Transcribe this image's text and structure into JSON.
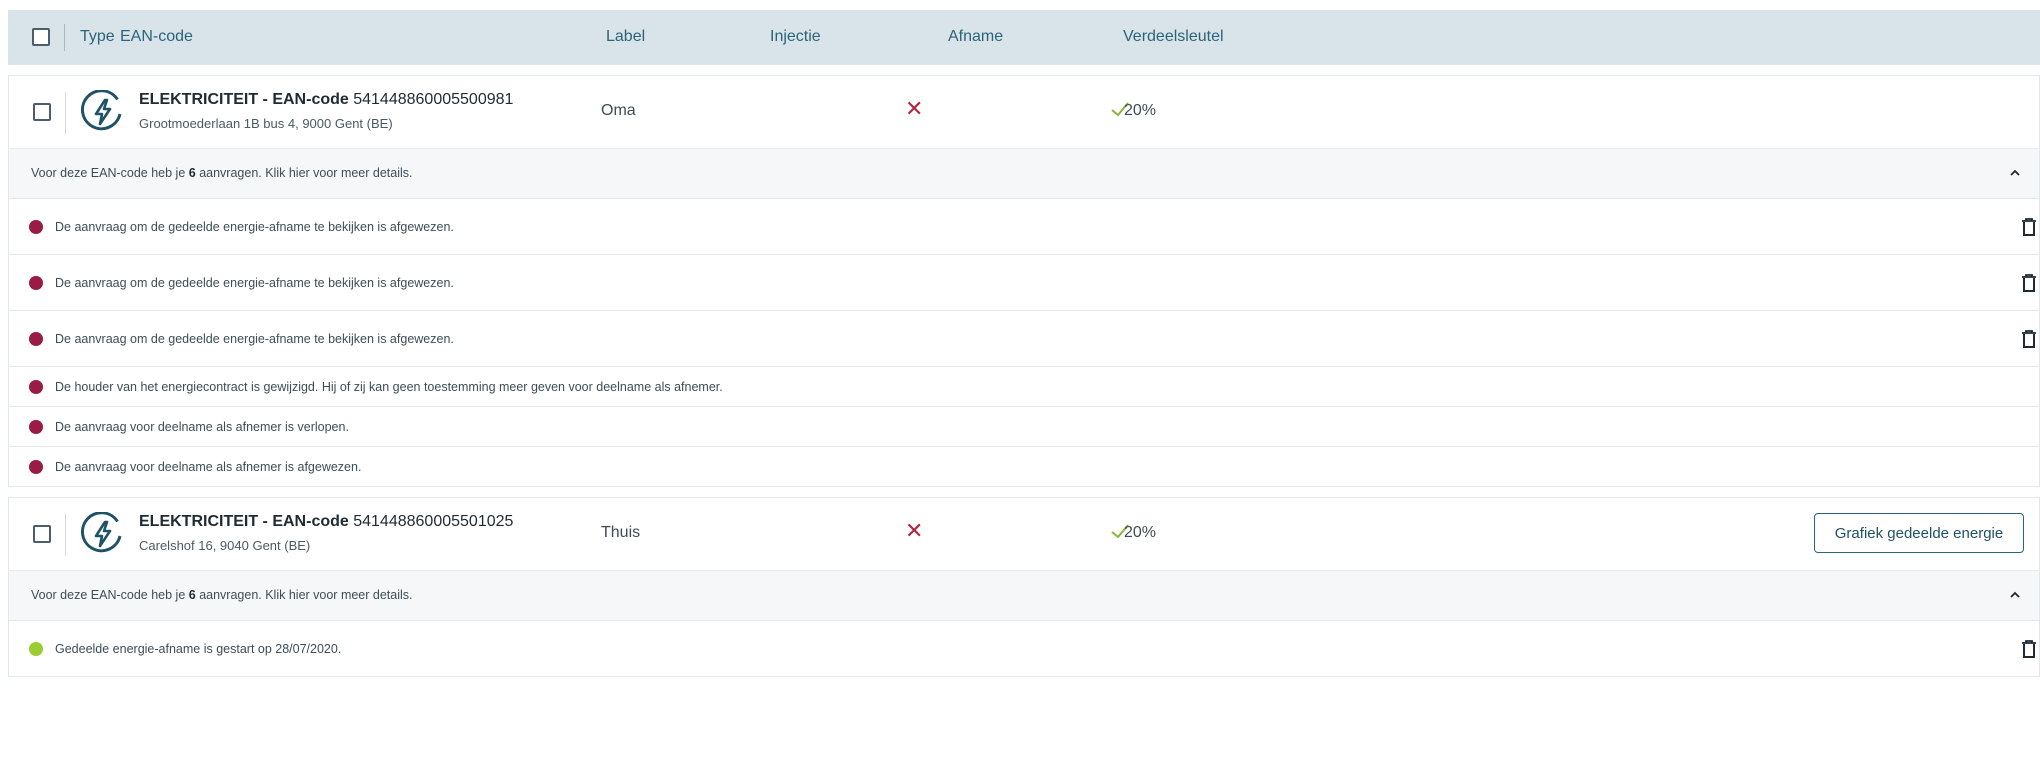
{
  "header": {
    "type": "Type",
    "ean": "EAN-code",
    "label": "Label",
    "injectie": "Injectie",
    "afname": "Afname",
    "verdeelsleutel": "Verdeelsleutel"
  },
  "colors": {
    "header_bg": "#d9e3ea",
    "accent": "#2b6478",
    "error_dot": "#9b1b45",
    "success_dot": "#9acd32",
    "cross": "#b0273f",
    "check": "#8ab43a"
  },
  "ean1": {
    "icon": "lightning-bolt-icon",
    "type_prefix": "ELEKTRICITEIT - EAN-code",
    "code": "541448860005500981",
    "address": "Grootmoederlaan 1B bus 4, 9000 Gent (BE)",
    "label": "Oma",
    "injectie_icon": "cross-icon",
    "afname_icon": "check-icon",
    "verdeelsleutel": "20%",
    "requests_summary": {
      "prefix": "Voor deze EAN-code heb je",
      "count": "6",
      "suffix": "aanvragen. Klik hier voor meer details."
    },
    "requests": [
      {
        "text": "De aanvraag om de gedeelde energie-afname te bekijken is afgewezen."
      },
      {
        "text": "De aanvraag om de gedeelde energie-afname te bekijken is afgewezen."
      },
      {
        "text": "De aanvraag om de gedeelde energie-afname te bekijken is afgewezen."
      },
      {
        "text": "De houder van het energiecontract is gewijzigd. Hij of zij kan geen toestemming meer geven voor deelname als afnemer."
      },
      {
        "text": "De aanvraag voor deelname als afnemer is verlopen."
      },
      {
        "text": "De aanvraag voor deelname als afnemer is afgewezen."
      }
    ]
  },
  "ean2": {
    "icon": "lightning-bolt-icon",
    "type_prefix": "ELEKTRICITEIT - EAN-code",
    "code": "541448860005501025",
    "address": "Carelshof 16, 9040 Gent (BE)",
    "label": "Thuis",
    "injectie_icon": "cross-icon",
    "afname_icon": "check-icon",
    "verdeelsleutel": "20%",
    "button": "Grafiek gedeelde energie",
    "requests_summary": {
      "prefix": "Voor deze EAN-code heb je",
      "count": "6",
      "suffix": "aanvragen. Klik hier voor meer details."
    },
    "requests": [
      {
        "text": "Gedeelde energie-afname is gestart op 28/07/2020."
      }
    ]
  }
}
